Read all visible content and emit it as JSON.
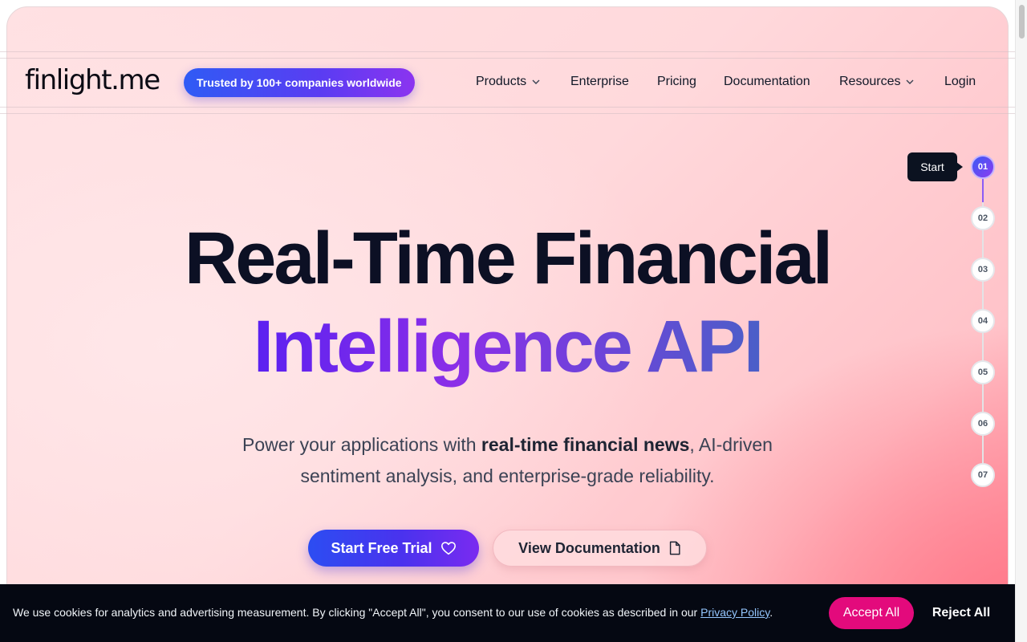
{
  "header": {
    "logo": "finlight.me",
    "badge": "Trusted by 100+ companies worldwide",
    "nav": {
      "products": "Products",
      "enterprise": "Enterprise",
      "pricing": "Pricing",
      "documentation": "Documentation",
      "resources": "Resources",
      "login": "Login"
    }
  },
  "hero": {
    "title_line1": "Real-Time Financial",
    "title_line2": "Intelligence API",
    "subtitle_part1": "Power your applications with ",
    "subtitle_bold": "real-time financial news",
    "subtitle_part2": ", AI-driven sentiment analysis, and enterprise-grade reliability.",
    "primary_button": "Start Free Trial",
    "secondary_button": "View Documentation"
  },
  "steps": {
    "tooltip": "Start",
    "items": [
      "01",
      "02",
      "03",
      "04",
      "05",
      "06",
      "07"
    ],
    "active_index": 0
  },
  "cookie": {
    "text": "We use cookies for analytics and advertising measurement. By clicking \"Accept All\", you consent to our use of cookies as described in our ",
    "link": "Privacy Policy",
    "suffix": ".",
    "accept": "Accept All",
    "reject": "Reject All"
  },
  "colors": {
    "accent_blue": "#2f5bf5",
    "accent_purple": "#7a2bf0",
    "cookie_accept": "#e30a7c",
    "title_dark": "#0c1024"
  },
  "icons": {
    "products_caret": "chevron-down-icon",
    "resources_caret": "chevron-down-icon",
    "primary_button_icon": "heart-icon",
    "secondary_button_icon": "document-icon"
  }
}
